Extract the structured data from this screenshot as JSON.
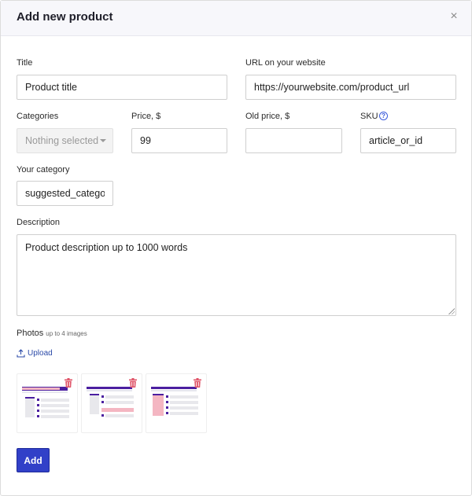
{
  "modal": {
    "title": "Add new product",
    "close_glyph": "×"
  },
  "form": {
    "title": {
      "label": "Title",
      "value": "Product title"
    },
    "url": {
      "label": "URL on your website",
      "value": "https://yourwebsite.com/product_url"
    },
    "categories": {
      "label": "Categories",
      "selected": "Nothing selected"
    },
    "price": {
      "label": "Price, $",
      "value": "99"
    },
    "old_price": {
      "label": "Old price, $",
      "value": ""
    },
    "sku": {
      "label": "SKU",
      "value": "article_or_id",
      "help_glyph": "?"
    },
    "your_category": {
      "label": "Your category",
      "value": "suggested_category"
    },
    "description": {
      "label": "Description",
      "value": "Product description up to 1000 words"
    }
  },
  "photos": {
    "label": "Photos",
    "hint": "up to 4 images",
    "upload_label": "Upload",
    "images": [
      {
        "icon": "page-screenshot-thumbnail",
        "variant": "pink-header"
      },
      {
        "icon": "page-screenshot-thumbnail",
        "variant": "pink-row"
      },
      {
        "icon": "page-screenshot-thumbnail",
        "variant": "pink-sidebar"
      }
    ]
  },
  "actions": {
    "add_label": "Add"
  },
  "colors": {
    "accent": "#3140c8",
    "link": "#2b4aa8",
    "trash": "#e0566a",
    "thumb_purple": "#4b1fa0",
    "thumb_pink": "#f4b6c2"
  }
}
